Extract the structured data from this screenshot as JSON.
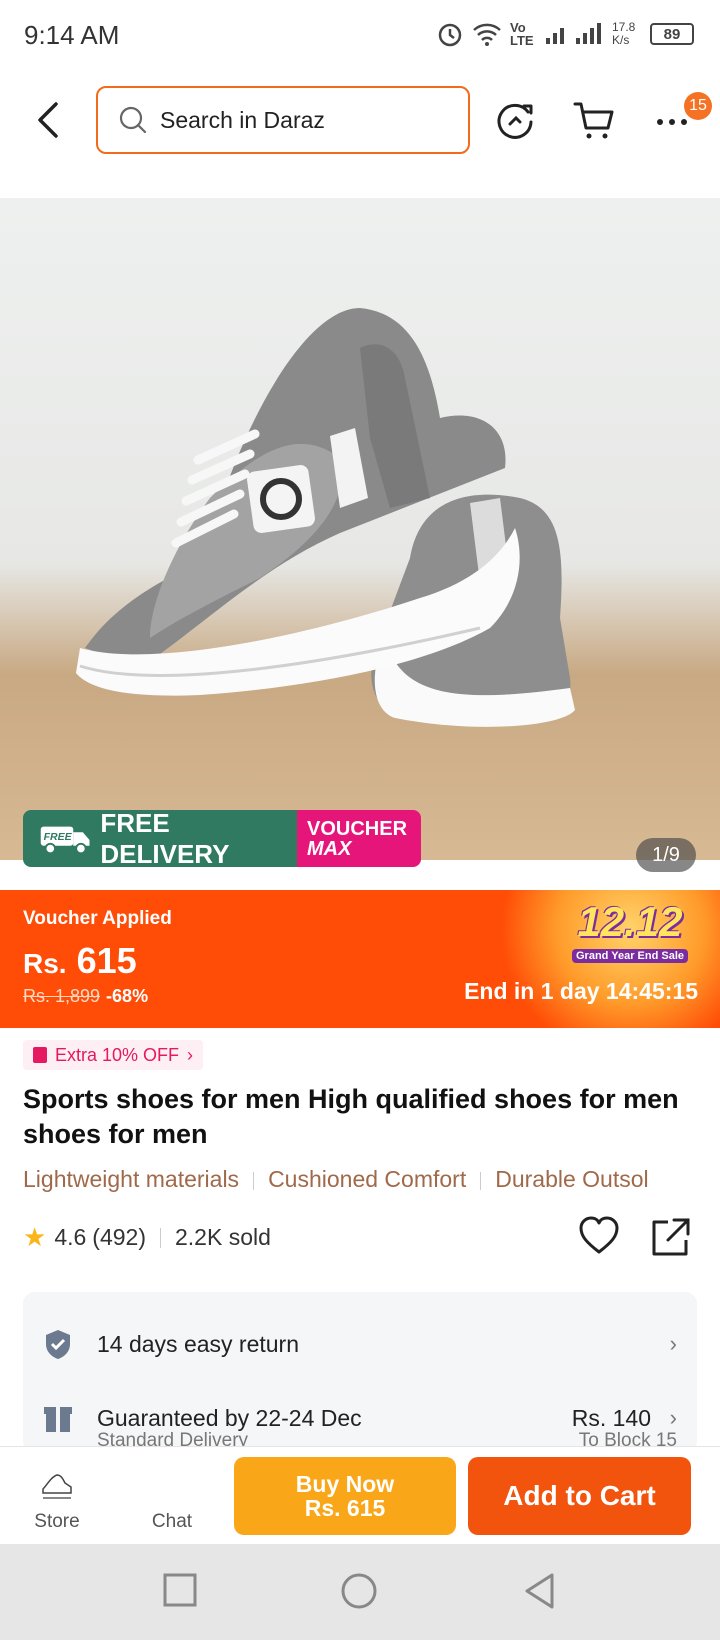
{
  "status_bar": {
    "time": "9:14 AM",
    "network": "Vo LTE",
    "speed": "17.8 K/s",
    "battery": "89"
  },
  "header": {
    "search_placeholder": "Search in Daraz",
    "cart_badge": "15"
  },
  "gallery": {
    "counter": "1/9",
    "promo_free_tag": "FREE",
    "promo_free_delivery": "FREE DELIVERY",
    "promo_voucher_line1": "VOUCHER",
    "promo_voucher_line2": "MAX"
  },
  "price": {
    "voucher_applied": "Voucher Applied",
    "currency": "Rs.",
    "current": "615",
    "original": "Rs. 1,899",
    "discount": "-68%",
    "campaign": "12.12",
    "campaign_sub": "Grand Year End Sale",
    "countdown": "End in 1 day 14:45:15"
  },
  "product": {
    "extra_offer": "Extra 10% OFF",
    "title": "Sports shoes for men  High qualified shoes for men  shoes for men",
    "features": [
      "Lightweight materials",
      "Cushioned Comfort",
      "Durable Outsol"
    ],
    "rating": "4.6",
    "reviews": "(492)",
    "sold": "2.2K sold"
  },
  "services": {
    "return_label": "14 days easy return",
    "delivery_label": "Guaranteed by 22-24 Dec",
    "delivery_fee": "Rs. 140",
    "delivery_type": "Standard Delivery",
    "delivery_location": "To Block 15"
  },
  "bottom_bar": {
    "store_label": "Store",
    "chat_label": "Chat",
    "buy_now_label": "Buy Now",
    "buy_now_price": "Rs. 615",
    "add_to_cart_label": "Add to Cart"
  },
  "colors": {
    "brand_orange": "#f57224",
    "price_banner": "#ff4d07",
    "buy_now": "#faa619",
    "add_to_cart": "#f2530d",
    "free_delivery": "#2f7a60",
    "voucher_max": "#e6157a"
  }
}
